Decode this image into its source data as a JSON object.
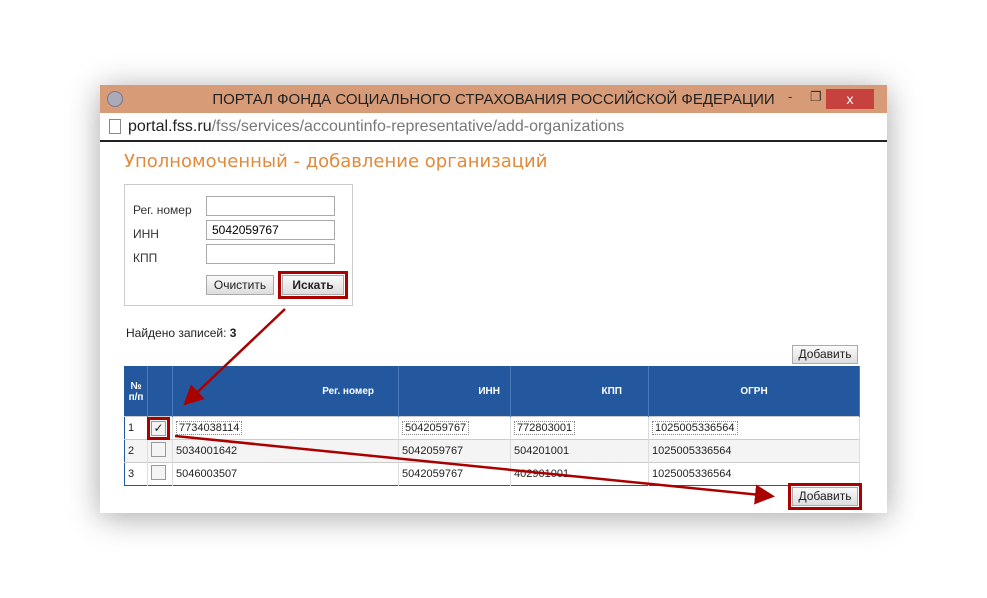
{
  "window": {
    "title": "ПОРТАЛ ФОНДА СОЦИАЛЬНОГО СТРАХОВАНИЯ РОССИЙСКОЙ ФЕДЕРАЦИИ",
    "min": "-",
    "max": "❐",
    "close": "x"
  },
  "address": {
    "host": "portal.fss.ru",
    "path": "/fss/services/accountinfo-representative/add-organizations"
  },
  "page_title": "Уполномоченный - добавление организаций",
  "search": {
    "reg_label": "Рег. номер",
    "reg_value": "",
    "inn_label": "ИНН",
    "inn_value": "5042059767",
    "kpp_label": "КПП",
    "kpp_value": "",
    "clear": "Очистить",
    "search": "Искать"
  },
  "found": {
    "label": "Найдено записей:",
    "count": "3"
  },
  "add_label": "Добавить",
  "table": {
    "headers": [
      "№ п/п",
      "",
      "Рег. номер",
      "ИНН",
      "КПП",
      "ОГРН"
    ],
    "rows": [
      {
        "n": "1",
        "checked": "✓",
        "reg": "7734038114",
        "inn": "5042059767",
        "kpp": "772803001",
        "ogrn": "1025005336564"
      },
      {
        "n": "2",
        "checked": "",
        "reg": "5034001642",
        "inn": "5042059767",
        "kpp": "504201001",
        "ogrn": "1025005336564"
      },
      {
        "n": "3",
        "checked": "",
        "reg": "5046003507",
        "inn": "5042059767",
        "kpp": "402901001",
        "ogrn": "1025005336564"
      }
    ]
  }
}
